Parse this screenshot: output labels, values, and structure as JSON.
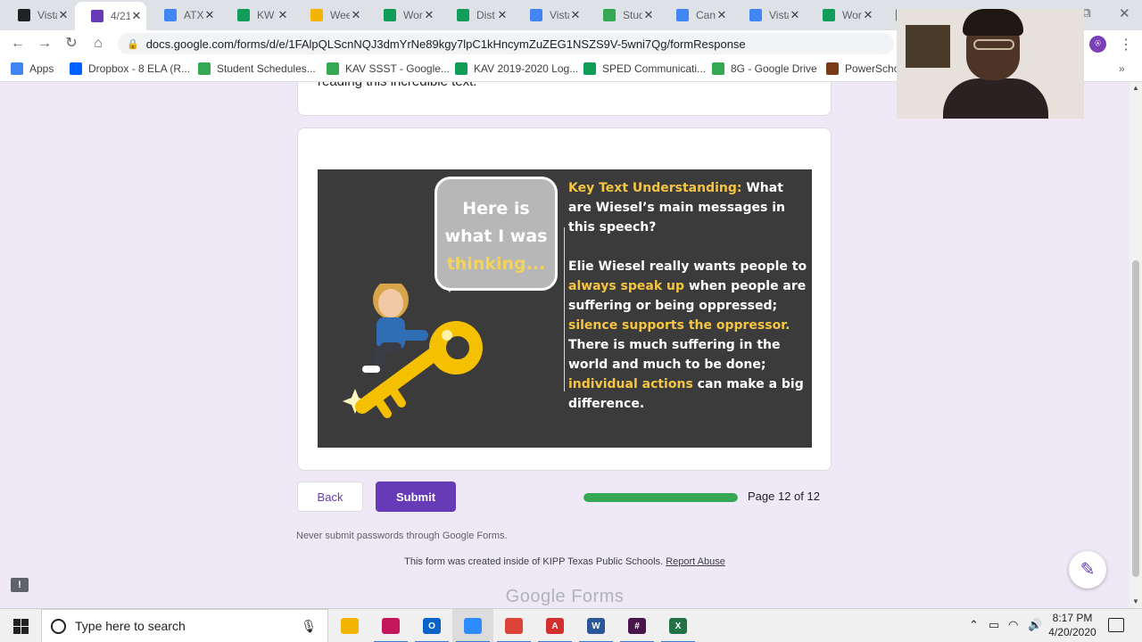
{
  "browser": {
    "tabs": [
      {
        "title": "Vista",
        "color": "#202124",
        "icon": "camera-icon"
      },
      {
        "title": "4/21",
        "color": "#673ab7",
        "icon": "forms-icon"
      },
      {
        "title": "ATX",
        "color": "#4285f4",
        "icon": "docs-icon"
      },
      {
        "title": "KW",
        "color": "#0f9d58",
        "icon": "sheets-icon"
      },
      {
        "title": "Wee",
        "color": "#f4b400",
        "icon": "slides-icon"
      },
      {
        "title": "Wor",
        "color": "#0f9d58",
        "icon": "sheets-icon"
      },
      {
        "title": "Dist",
        "color": "#0f9d58",
        "icon": "sheets-icon"
      },
      {
        "title": "Vista",
        "color": "#4285f4",
        "icon": "docs-icon"
      },
      {
        "title": "Stud",
        "color": "#34a853",
        "icon": "drive-icon"
      },
      {
        "title": "Can",
        "color": "#4285f4",
        "icon": "docs-icon"
      },
      {
        "title": "Vista",
        "color": "#4285f4",
        "icon": "docs-icon"
      },
      {
        "title": "Wor",
        "color": "#0f9d58",
        "icon": "sheets-icon"
      },
      {
        "title": "Ob",
        "color": "#5f6368",
        "icon": "globe-icon"
      }
    ],
    "url": "docs.google.com/forms/d/e/1FAlpQLScnNQJ3dmYrNe89kgy7lpC1kHncymZuZEG1NSZS9V-5wni7Qg/formResponse",
    "profile_initial": "⍟",
    "bookmarks": [
      {
        "label": "Apps",
        "color": "#4285f4",
        "icon": "apps-grid-icon"
      },
      {
        "label": "Dropbox - 8 ELA (R...",
        "color": "#0061ff",
        "icon": "dropbox-icon"
      },
      {
        "label": "Student Schedules...",
        "color": "#34a853",
        "icon": "drive-icon"
      },
      {
        "label": "KAV SSST - Google...",
        "color": "#34a853",
        "icon": "drive-icon"
      },
      {
        "label": "KAV 2019-2020 Log...",
        "color": "#0f9d58",
        "icon": "sheets-icon"
      },
      {
        "label": "SPED Communicati...",
        "color": "#0f9d58",
        "icon": "sheets-icon"
      },
      {
        "label": "8G - Google Drive",
        "color": "#34a853",
        "icon": "drive-icon"
      },
      {
        "label": "PowerSchool",
        "color": "#7a3b1b",
        "icon": "powerschool-icon"
      }
    ]
  },
  "form": {
    "prev_card_text": "reading this incredible text.",
    "slide": {
      "bubble_line1": "Here is",
      "bubble_line2": "what I was",
      "bubble_line3": "thinking...",
      "kt_label": "Key Text Understanding:",
      "kt_question": " What are Wiesel’s main messages in this speech?",
      "a1": "Elie Wiesel really wants people to ",
      "a2": "always speak up",
      "a3": " when people are suffering or being oppressed; ",
      "a4": "silence supports the oppressor.",
      "a5": " There is much suffering in the world and much to be done; ",
      "a6": "individual actions",
      "a7": " can make a big difference."
    },
    "back_label": "Back",
    "submit_label": "Submit",
    "progress_fraction": 1.0,
    "page_label": "Page 12 of 12",
    "never_submit": "Never submit passwords through Google Forms.",
    "created_text": "This form was created inside of KIPP Texas Public Schools.",
    "report_abuse": "Report Abuse",
    "footer_logo": "Google Forms"
  },
  "taskbar": {
    "search_placeholder": "Type here to search",
    "apps": [
      {
        "name": "file-explorer",
        "color": "#f4b400",
        "label": ""
      },
      {
        "name": "snip-tool",
        "color": "#c2185b",
        "label": ""
      },
      {
        "name": "outlook",
        "color": "#0a64c8",
        "label": "O"
      },
      {
        "name": "zoom",
        "color": "#2d8cff",
        "label": ""
      },
      {
        "name": "chrome",
        "color": "#db4437",
        "label": ""
      },
      {
        "name": "acrobat",
        "color": "#d32f2f",
        "label": "A"
      },
      {
        "name": "word",
        "color": "#2b579a",
        "label": "W"
      },
      {
        "name": "slack",
        "color": "#4a154b",
        "label": "#"
      },
      {
        "name": "excel",
        "color": "#217346",
        "label": "X"
      }
    ],
    "time": "8:17 PM",
    "date": "4/20/2020"
  }
}
